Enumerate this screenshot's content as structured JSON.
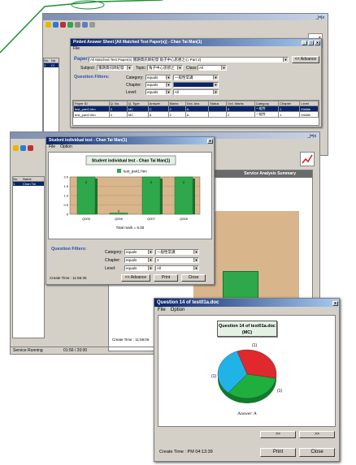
{
  "win1": {
    "title": "Pinbrd Answer Sheet [All Matched Test Paper(s)] - Chan Tai Man(1)",
    "menu": "File",
    "paper_label": "Paper:",
    "paper_value": "All Matched Test Paper(s) 獲題資訊師紀發 角子中心思想之心 Part 2)",
    "subject_label": "Subject:",
    "subject_value": "獲題資訊師紀發",
    "topic_label": "Topic:",
    "topic_value": "角子中心思想之",
    "class_label": "Class:",
    "class_value": "All",
    "advance_btn": "<< Advance",
    "filters_label": "Question Filters:",
    "category_label": "Category:",
    "category_op": "equals",
    "category_value": "一般性常識",
    "chapter_label": "Chapter:",
    "chapter_op": "equals",
    "level_label": "Level:",
    "level_op": "equals",
    "level_value": "All",
    "table_headers": [
      "Paper ID",
      "Q. No.",
      "Q. Type",
      "Answer",
      "Marks",
      "Grd. Ans",
      "Status",
      "Grd. Marks",
      "Category",
      "Chapter",
      "Level"
    ],
    "rows": [
      [
        "test_part2.htm",
        "3",
        "MC",
        "C",
        "2",
        "A",
        "",
        "0",
        "一般性",
        "1",
        "Middle"
      ],
      [
        "test_part2.htm",
        "4",
        "MC",
        "A",
        "2",
        "A",
        "",
        "2",
        "一般性",
        "1",
        "Middle"
      ]
    ]
  },
  "bgwin1": {
    "left_cols": [
      "No.",
      "Na"
    ],
    "left_row": [
      "1",
      "Cl"
    ],
    "minmax": "_|=|x"
  },
  "win2": {
    "title": "Student individual test - Chan Tai Man(1)",
    "menu": [
      "File",
      "Option"
    ],
    "chart_title": "Student individual test - Chan Tai Man(1)",
    "total": "Total mark = 6.00",
    "filters_label": "Question Filters:",
    "category_label": "Category:",
    "category_op": "equals",
    "category_value": "一般性常識",
    "chapter_label": "Chapter:",
    "chapter_op": "equals",
    "chapter_value": "1",
    "level_label": "Level:",
    "level_op": "equals",
    "level_value": "All",
    "create_time": "Create Time : 11:55:35",
    "btn_advance": "<< Advance",
    "btn_print": "Print",
    "btn_close": "Close"
  },
  "bgwin2": {
    "left_cols": [
      "No.",
      "Name"
    ],
    "left_row": [
      "1",
      "Chan Tai"
    ],
    "summary_title": "Service Analysis Summary",
    "axis_labels": [
      "test_part1.htm",
      "test_part2.htm"
    ],
    "create_time": "Create Time : 11:59:06",
    "status": "Service Running",
    "time": "01:56 / 20:00",
    "re": "Re"
  },
  "win3": {
    "title": "Question 14 of test01a.doc",
    "menu": [
      "File",
      "Option"
    ],
    "chart_title_1": "Question 14 of test01a.doc",
    "chart_title_2": "(MC)",
    "answer": "Answer: A",
    "label_top": "(1)",
    "label_left": "(1)",
    "label_right": "(1)",
    "nav_next": ">>",
    "nav_last": ">>",
    "create_time": "Create Time : PM 04:13:39",
    "btn_print": "Print",
    "btn_close": "Close"
  },
  "chart_data": [
    {
      "type": "bar",
      "title": "Student individual test - Chan Tai Man(1)",
      "categories": [
        "Q005",
        "Q006",
        "Q007",
        "Q008"
      ],
      "series": [
        {
          "name": "test_part1.htm",
          "values": [
            2,
            0,
            2,
            2
          ]
        }
      ],
      "ylim": [
        0,
        2.0
      ],
      "yticks": [
        "2.0",
        "1.5",
        "1.0",
        "0.5",
        "0"
      ],
      "data_labels": [
        "2",
        "0",
        "2",
        "2"
      ],
      "colors": {
        "bar": "#2ea84a",
        "plot_bg": "#d9b58c"
      }
    },
    {
      "type": "pie",
      "title": "Question 14 of test01a.doc (MC)",
      "labels": [
        "(1)",
        "(1)",
        "(1)"
      ],
      "values": [
        1,
        1,
        1
      ],
      "colors": [
        "#e0282d",
        "#1eaf3d",
        "#20b3e6"
      ]
    }
  ],
  "colors": {
    "titlebar": "#0a246a",
    "accent_blue": "#2b4ea8",
    "window_gray": "#d4d0c8"
  }
}
